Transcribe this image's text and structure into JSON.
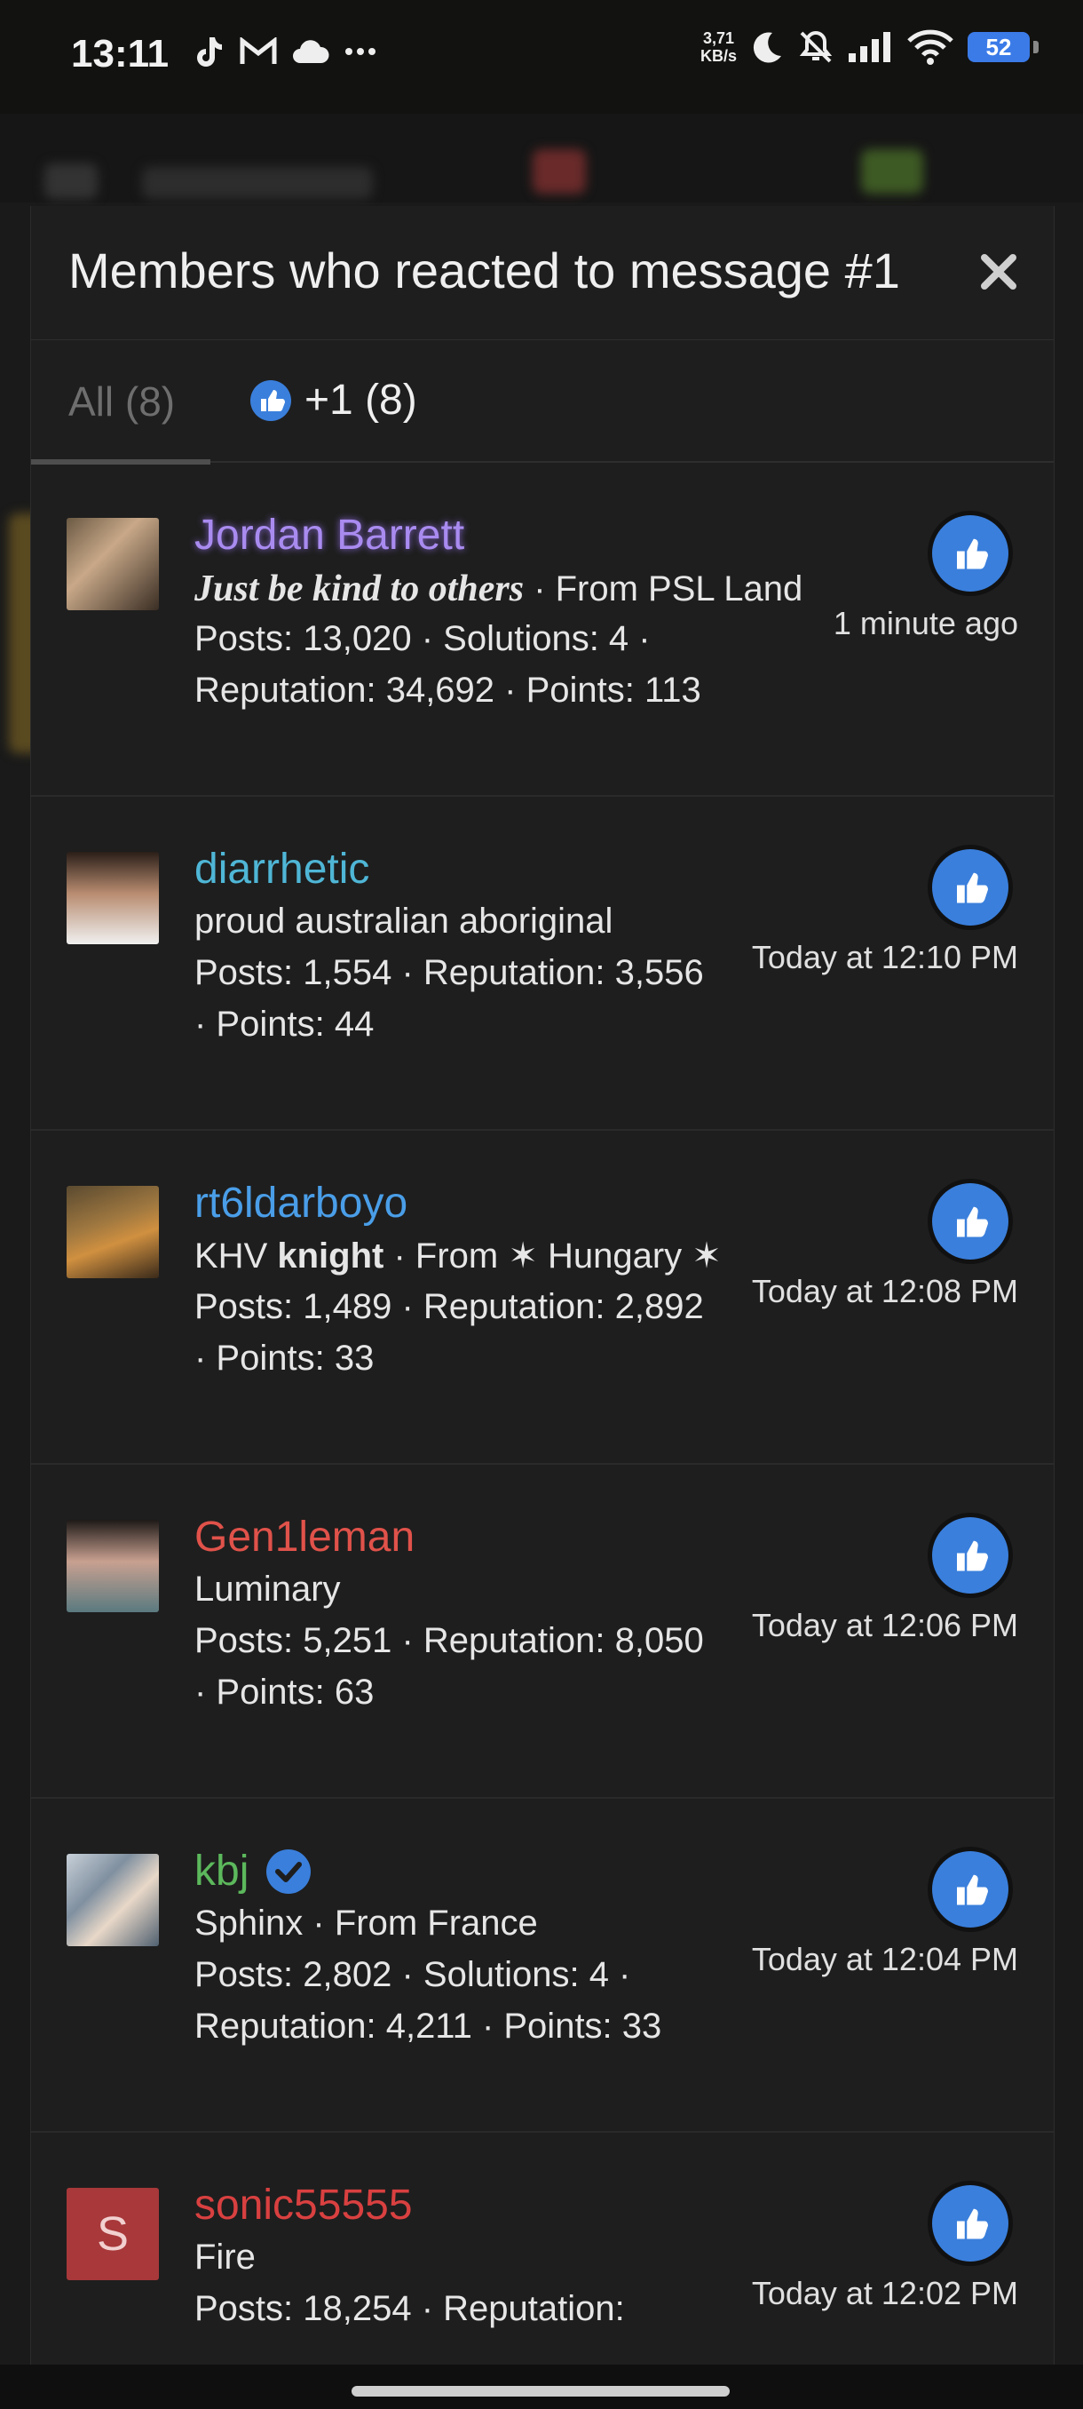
{
  "status_bar": {
    "time": "13:11",
    "net_speed_value": "3,71",
    "net_speed_unit": "KB/s",
    "battery": "52",
    "left_icons": [
      "tiktok-icon",
      "gmail-icon",
      "cloud-icon",
      "more-icon"
    ],
    "right_icons": [
      "moon-icon",
      "bell-off-icon",
      "signal-icon",
      "wifi-icon",
      "battery-icon"
    ]
  },
  "modal": {
    "title": "Members who reacted to message #1",
    "tabs": {
      "all_label": "All (8)",
      "plus_one_label": "+1 (8)"
    }
  },
  "members": [
    {
      "name": "Jordan Barrett",
      "name_color": "#a98bf0",
      "title": "Just be kind to others",
      "location": " · From PSL Land",
      "line2": "Posts: 13,020 · Solutions: 4 ·",
      "line3": "Reputation: 34,692 · Points: 113",
      "time": "1 minute ago"
    },
    {
      "name": "diarrhetic",
      "name_color": "#4fb6d6",
      "title": "proud australian aboriginal",
      "line2": "Posts: 1,554 · Reputation: 3,556",
      "line3": "· Points: 44",
      "time": "Today at 12:10 PM"
    },
    {
      "name": "rt6ldarboyo",
      "name_color": "#4a9ee8",
      "title_prefix": "KHV ",
      "title_bold": "knight",
      "location": " · From ✶ Hungary ✶",
      "line2": "Posts: 1,489 · Reputation: 2,892",
      "line3": "· Points: 33",
      "time": "Today at 12:08 PM"
    },
    {
      "name": "Gen1leman",
      "name_color": "#e0524a",
      "title": "Luminary",
      "line2": "Posts: 5,251 · Reputation: 8,050",
      "line3": "· Points: 63",
      "time": "Today at 12:06 PM"
    },
    {
      "name": "kbj",
      "name_color": "#5cb85c",
      "title": "Sphinx · From France",
      "line2": "Posts: 2,802 · Solutions: 4 ·",
      "line3": "Reputation: 4,211 · Points: 33",
      "time": "Today at 12:04 PM"
    },
    {
      "name": "sonic55555",
      "name_color": "#d94040",
      "avatar_letter": "S",
      "title": "Fire",
      "line2": "Posts: 18,254 · Reputation:",
      "time": "Today at 12:02 PM"
    }
  ],
  "colors": {
    "modal_bg": "#1e1e1e",
    "reaction_blue": "#3a7fdc",
    "verified_blue": "#3a7fdc"
  }
}
